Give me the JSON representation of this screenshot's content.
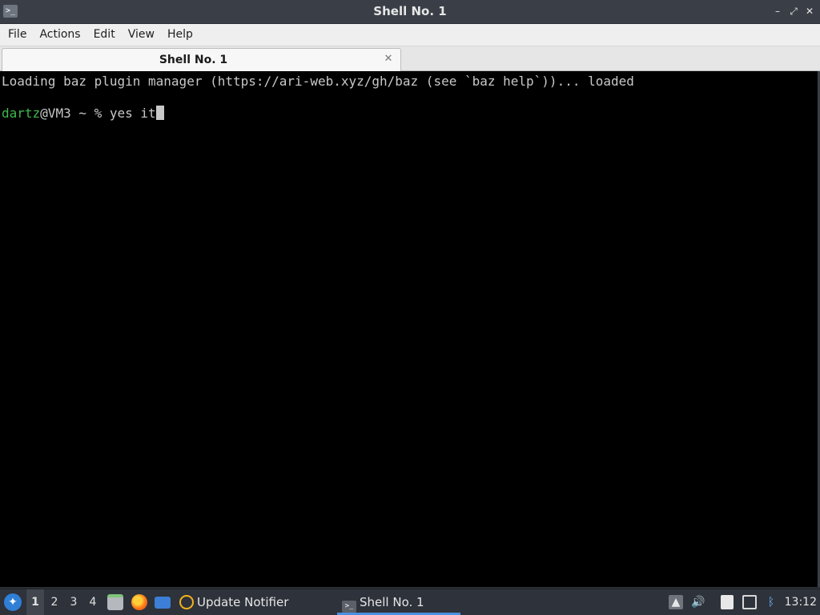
{
  "window": {
    "title": "Shell No. 1",
    "app_icon_glyph": ">_",
    "controls": {
      "minimize": "–",
      "restore": "⤢",
      "close": "✕"
    }
  },
  "menubar": {
    "items": [
      {
        "label": "File"
      },
      {
        "label": "Actions"
      },
      {
        "label": "Edit"
      },
      {
        "label": "View"
      },
      {
        "label": "Help"
      }
    ]
  },
  "tabs": [
    {
      "label": "Shell No. 1",
      "close": "✕"
    }
  ],
  "terminal": {
    "line1": "Loading baz plugin manager (https://ari-web.xyz/gh/baz (see `baz help`))... loaded",
    "prompt_user": "dartz",
    "prompt_host": "@VM3 ~ % ",
    "command": "yes it"
  },
  "taskbar": {
    "start_icon": "start-menu-icon",
    "workspaces": [
      "1",
      "2",
      "3",
      "4"
    ],
    "launchers": [
      {
        "name": "file-manager-icon"
      },
      {
        "name": "firefox-icon"
      },
      {
        "name": "desktop-icon"
      }
    ],
    "tasks": [
      {
        "label": "Update Notifier",
        "icon": "update-notifier-icon"
      },
      {
        "label": "Shell No. 1",
        "icon": "terminal-icon"
      }
    ],
    "tray": [
      {
        "name": "tray-expand-icon"
      },
      {
        "name": "volume-icon"
      },
      {
        "name": "clipboard-icon"
      },
      {
        "name": "network-icon"
      },
      {
        "name": "bluetooth-icon"
      }
    ],
    "clock": "13:12"
  },
  "colors": {
    "terminal_bg": "#000000",
    "terminal_fg": "#c8c8c8",
    "prompt_user": "#3fb94f",
    "accent": "#4a90e2"
  }
}
